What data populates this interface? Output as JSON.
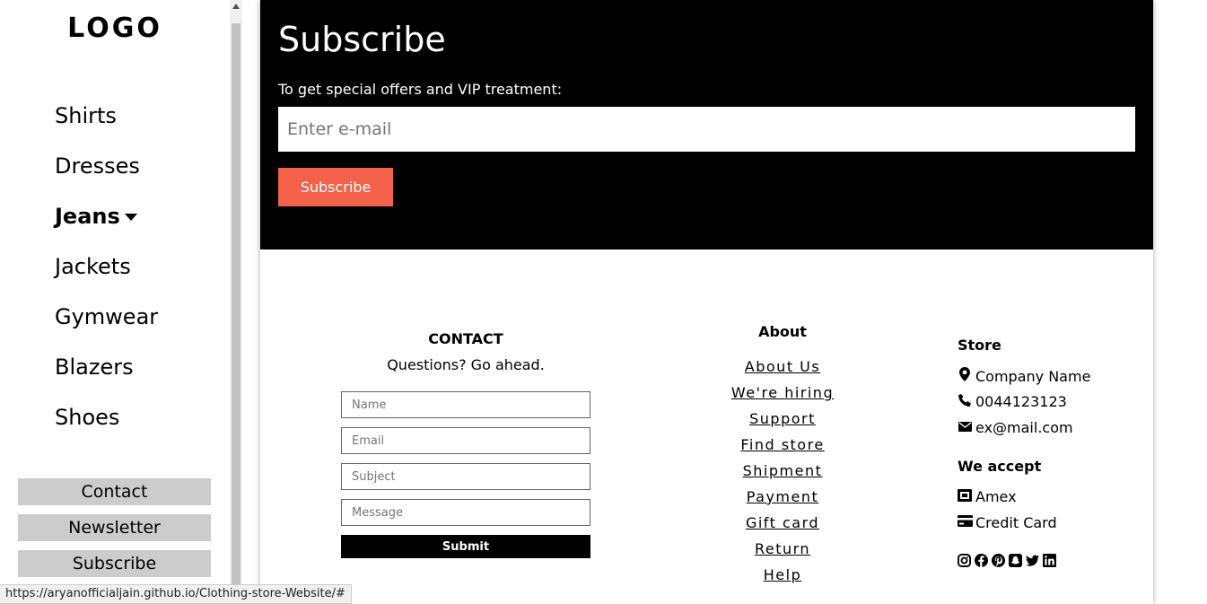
{
  "sidebar": {
    "logo": "LOGO",
    "items": [
      {
        "label": "Shirts"
      },
      {
        "label": "Dresses"
      },
      {
        "label": "Jeans"
      },
      {
        "label": "Jackets"
      },
      {
        "label": "Gymwear"
      },
      {
        "label": "Blazers"
      },
      {
        "label": "Shoes"
      }
    ],
    "buttons": [
      "Contact",
      "Newsletter",
      "Subscribe"
    ]
  },
  "subscribe": {
    "title": "Subscribe",
    "text": "To get special offers and VIP treatment:",
    "email_placeholder": "Enter e-mail",
    "button": "Subscribe",
    "button_color": "#f4624b"
  },
  "contact": {
    "title": "CONTACT",
    "subtitle": "Questions? Go ahead.",
    "fields": {
      "name": "Name",
      "email": "Email",
      "subject": "Subject",
      "message": "Message"
    },
    "submit": "Submit"
  },
  "about": {
    "title": "About",
    "links": [
      "About Us",
      "We're hiring",
      "Support",
      "Find store",
      "Shipment",
      "Payment",
      "Gift card",
      "Return",
      "Help"
    ]
  },
  "store": {
    "title": "Store",
    "company": "Company Name",
    "phone": "0044123123",
    "email": "ex@mail.com",
    "accept_title": "We accept",
    "amex": "Amex",
    "credit_card": "Credit Card",
    "socials": [
      "instagram-icon",
      "facebook-icon",
      "pinterest-icon",
      "snapchat-icon",
      "twitter-icon",
      "linkedin-icon"
    ]
  },
  "statusbar": {
    "url": "https://aryanofficialjain.github.io/Clothing-store-Website/#"
  }
}
